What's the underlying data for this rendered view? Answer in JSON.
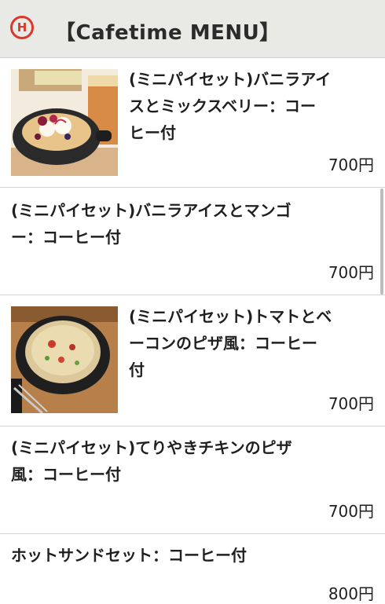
{
  "header": {
    "logo_glyph": "H",
    "title": "【Cafetime MENU】"
  },
  "menu": {
    "items": [
      {
        "name_line1": "(ミニパイセット)バニラアイ",
        "name_line2": "スとミックスベリー：コー",
        "name_line3": "ヒー付",
        "price": "700円",
        "image": "ice-cream-pie-photo"
      },
      {
        "name_line1": "(ミニパイセット)バニラアイスとマンゴ",
        "name_line2": "ー：コーヒー付",
        "price": "700円"
      },
      {
        "name_line1": "(ミニパイセット)トマトとベ",
        "name_line2": "ーコンのピザ風：コーヒー",
        "name_line3": "付",
        "price": "700円",
        "image": "pizza-pie-photo"
      },
      {
        "name_line1": "(ミニパイセット)てりやきチキンのピザ",
        "name_line2": "風：コーヒー付",
        "price": "700円"
      },
      {
        "name_line1": "ホットサンドセット：コーヒー付",
        "price": "800円"
      }
    ]
  },
  "colors": {
    "header_bg": "#e9e9e6",
    "logo_red": "#d9382e",
    "divider": "#d4d4d4"
  }
}
